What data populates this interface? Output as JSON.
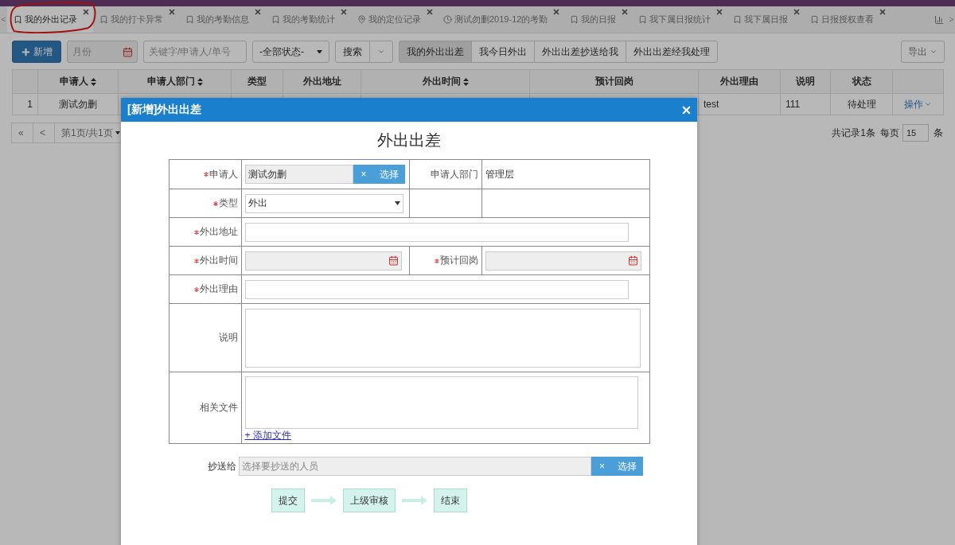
{
  "tab_bar": {
    "scroll_left": "<",
    "scroll_right": ">",
    "tabs": [
      {
        "label": "我的外出记录",
        "kind": "bookmark",
        "selected": true
      },
      {
        "label": "我的打卡异常",
        "kind": "bookmark",
        "selected": false
      },
      {
        "label": "我的考勤信息",
        "kind": "bookmark",
        "selected": false
      },
      {
        "label": "我的考勤统计",
        "kind": "bookmark",
        "selected": false
      },
      {
        "label": "我的定位记录",
        "kind": "pin",
        "selected": false
      },
      {
        "label": "测试勿删2019-12的考勤",
        "kind": "clock",
        "selected": false
      },
      {
        "label": "我的日报",
        "kind": "bookmark",
        "selected": false
      },
      {
        "label": "我下属日报统计",
        "kind": "bookmark",
        "selected": false
      },
      {
        "label": "我下属日报",
        "kind": "bookmark",
        "selected": false
      },
      {
        "label": "日报授权查看",
        "kind": "bookmark",
        "selected": false
      }
    ]
  },
  "toolbar": {
    "add_button": "新增",
    "month": {
      "placeholder": "月份"
    },
    "keyword": {
      "placeholder": "关键字/申请人/单号"
    },
    "status_select": "-全部状态-",
    "search_button": "搜索",
    "views": [
      {
        "label": "我的外出出差",
        "selected": true
      },
      {
        "label": "我今日外出",
        "selected": false
      },
      {
        "label": "外出出差抄送给我",
        "selected": false
      },
      {
        "label": "外出出差经我处理",
        "selected": false
      }
    ],
    "export_button": "导出"
  },
  "table": {
    "columns": [
      {
        "label": "申请人",
        "sortable": true
      },
      {
        "label": "申请人部门",
        "sortable": true
      },
      {
        "label": "类型",
        "sortable": false
      },
      {
        "label": "外出地址",
        "sortable": false
      },
      {
        "label": "外出时间",
        "sortable": true
      },
      {
        "label": "预计回岗",
        "sortable": false
      },
      {
        "label": "外出理由",
        "sortable": false
      },
      {
        "label": "说明",
        "sortable": false
      },
      {
        "label": "状态",
        "sortable": false
      }
    ],
    "rows": [
      {
        "index": "1",
        "applicant": "测试勿删",
        "reason": "test",
        "note": "111",
        "status": "待处理",
        "action": "操作"
      }
    ]
  },
  "pagination": {
    "first": "«",
    "prev": "<",
    "page": "第1页/共1页",
    "total": "共记录1条",
    "per_page_label": "每页",
    "per_page": "15",
    "per_page_unit": "条"
  },
  "dialog": {
    "title": "[新增]外出出差",
    "heading": "外出出差",
    "form": {
      "applicant": {
        "label": "申请人",
        "required": true,
        "value": "测试勿删",
        "clear": "×",
        "pick": "选择"
      },
      "department": {
        "label": "申请人部门",
        "required": false,
        "value": "管理层"
      },
      "type": {
        "label": "类型",
        "required": true,
        "value": "外出"
      },
      "address": {
        "label": "外出地址",
        "required": true
      },
      "out_time": {
        "label": "外出时间",
        "required": true
      },
      "return_time": {
        "label": "预计回岗",
        "required": true
      },
      "reason": {
        "label": "外出理由",
        "required": true
      },
      "note": {
        "label": "说明",
        "required": false
      },
      "files": {
        "label": "相关文件",
        "required": false,
        "add_link": "+ 添加文件"
      }
    },
    "cc": {
      "label": "抄送给",
      "placeholder": "选择要抄送的人员",
      "clear": "×",
      "pick": "选择"
    },
    "flow": [
      "提交",
      "上级审核",
      "结束"
    ]
  }
}
